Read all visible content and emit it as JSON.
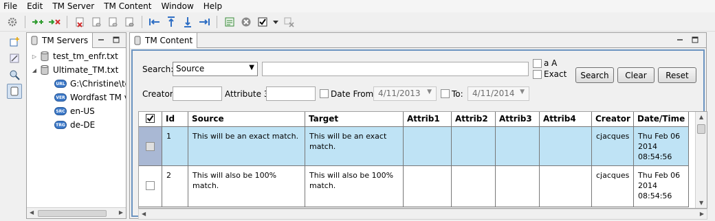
{
  "menu": [
    "File",
    "Edit",
    "TM Server",
    "TM Content",
    "Window",
    "Help"
  ],
  "toolbar": {
    "icons": [
      "gear-icon",
      "add-match-icon",
      "remove-match-icon",
      "delete-tm-icon",
      "tm-db-icon-1",
      "tm-db-icon-2",
      "tm-db-icon-3",
      "first-icon",
      "up-icon",
      "down-icon",
      "last-icon",
      "export-icon",
      "cancel-icon",
      "checkbox-icon",
      "dropdown-icon",
      "clear-filter-icon"
    ]
  },
  "servers_panel": {
    "tab_label": "TM Servers",
    "tree": [
      {
        "label": "test_tm_enfr.txt",
        "level": 0,
        "expanded": false
      },
      {
        "label": "Ultimate_TM.txt",
        "level": 0,
        "expanded": true
      },
      {
        "label": "G:\\Christine\\tes",
        "level": 1,
        "badge": "URL"
      },
      {
        "label": "Wordfast TM v.",
        "level": 1,
        "badge": "VER"
      },
      {
        "label": "en-US",
        "level": 1,
        "badge": "SRC"
      },
      {
        "label": "de-DE",
        "level": 1,
        "badge": "TRG"
      }
    ]
  },
  "content_panel": {
    "tab_label": "TM Content",
    "search_label": "Search:",
    "search_field_selected": "Source",
    "search_text": "",
    "case_label": "a A",
    "exact_label": "Exact",
    "search_button": "Search",
    "clear_button": "Clear",
    "reset_button": "Reset",
    "creator_label": "Creator",
    "creator_value": "",
    "attribute3_label": "Attribute 3",
    "attribute3_value": "",
    "date_from_label": "Date From:",
    "date_from_value": "4/11/2013",
    "to_label": "To:",
    "to_value": "4/11/2014"
  },
  "table": {
    "columns": [
      "Id",
      "Source",
      "Target",
      "Attrib1",
      "Attrib2",
      "Attrib3",
      "Attrib4",
      "Creator",
      "Date/Time"
    ],
    "rows": [
      {
        "id": "1",
        "source": "This will be an exact match.",
        "target_line1": "This will be an exact",
        "target_line2": "match.",
        "attrib1": "",
        "attrib2": "",
        "attrib3": "",
        "attrib4": "",
        "creator": "cjacques",
        "date_line1": "Thu Feb 06",
        "date_line2": "2014",
        "date_line3": "08:54:56"
      },
      {
        "id": "2",
        "source": "This will also be 100% match.",
        "target_line1": "This will also be 100%",
        "target_line2": "match.",
        "attrib1": "",
        "attrib2": "",
        "attrib3": "",
        "attrib4": "",
        "creator": "cjacques",
        "date_line1": "Thu Feb 06",
        "date_line2": "2014",
        "date_line3": "08:54:56"
      }
    ]
  },
  "colors": {
    "selection_row": "#bfe3f5",
    "frame_accent": "#6a93c0",
    "badge": "#3b78c8"
  }
}
